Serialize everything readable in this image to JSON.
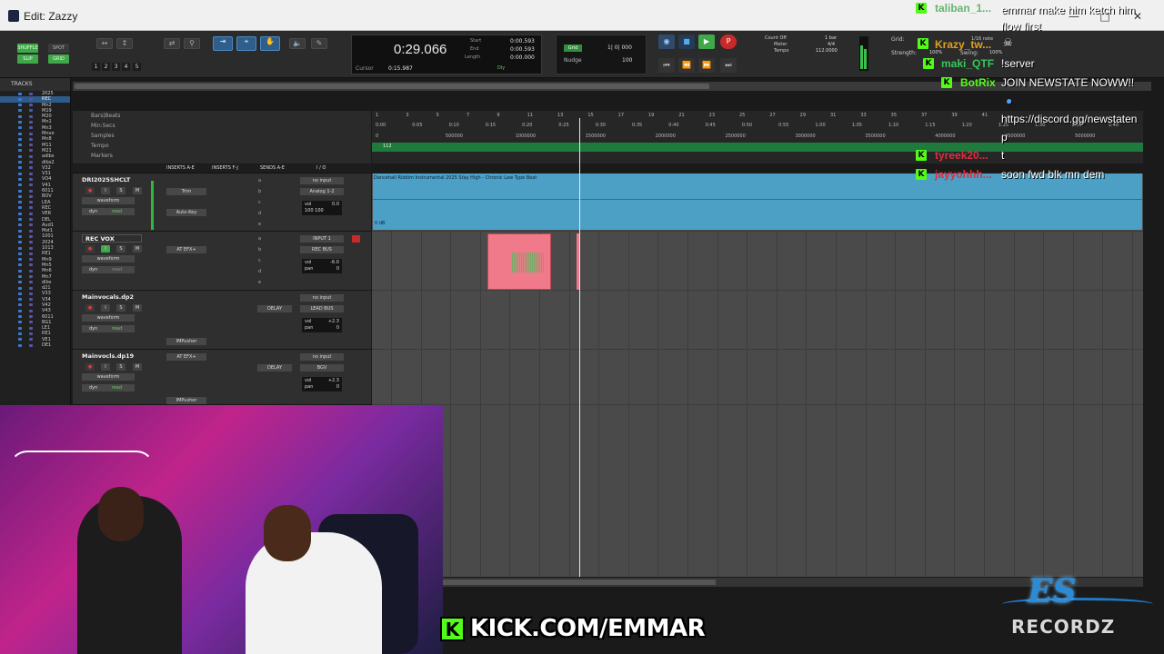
{
  "window": {
    "title": "Edit: Zazzy"
  },
  "toolbar": {
    "modes": [
      "SHUFFLE",
      "SPOT",
      "SLIP",
      "GRID"
    ],
    "zoom_presets": [
      "1",
      "2",
      "3",
      "4",
      "5"
    ],
    "counter": {
      "main": "0:29.066",
      "cursor_label": "Cursor",
      "cursor_value": "0:15.987",
      "start_label": "Start",
      "start_value": "0:00.593",
      "end_label": "End",
      "end_value": "0:00.593",
      "length_label": "Length",
      "length_value": "0:00.000",
      "dly_label": "Dly"
    },
    "grid": {
      "label": "Grid",
      "value": "1| 0| 000",
      "nudge_label": "Nudge",
      "nudge_value": "100"
    },
    "tempo": {
      "count_off": "Count Off",
      "meter": "Meter",
      "tempo_label": "Tempo",
      "bars": "1 bar",
      "meter_value": "4/4",
      "tempo_value": "112.0000"
    },
    "grid_strength": {
      "grid_label": "Grid:",
      "strength_label": "Strength:",
      "note": "1/16 note",
      "strength": "100%",
      "swing_label": "Swing:",
      "swing": "100%"
    }
  },
  "tracks_panel": {
    "header": "TRACKS",
    "items": [
      "2025",
      "REC",
      "Mn2",
      "M19",
      "M20",
      "Mn1",
      "Mn3",
      "Mnvo",
      "Mn8",
      "M11",
      "M21",
      "adlbs",
      "dlbs2",
      "V32",
      "V31",
      "VO4",
      "V41",
      "6011",
      "BOV",
      "LEA",
      "REC",
      "VER",
      "DEL",
      "Aud1",
      "Mst1",
      "1001",
      "2024",
      "1013",
      "RE1",
      "Mn9",
      "Mn5",
      "Mn6",
      "Mn7",
      "dlbs",
      "d21",
      "V33",
      "V34",
      "V42",
      "V43",
      "6011",
      "BG1",
      "LE1",
      "RE1",
      "VE1",
      "DE1"
    ]
  },
  "rulers": {
    "labels": [
      "Bars|Beats",
      "Min:Secs",
      "Samples",
      "Tempo",
      "Markers"
    ],
    "bars": [
      "1",
      "3",
      "5",
      "7",
      "9",
      "11",
      "13",
      "15",
      "17",
      "19",
      "21",
      "23",
      "25",
      "27",
      "29",
      "31",
      "33",
      "35",
      "37",
      "39",
      "41"
    ],
    "minsecs": [
      "0:00",
      "0:05",
      "0:10",
      "0:15",
      "0:20",
      "0:25",
      "0:30",
      "0:35",
      "0:40",
      "0:45",
      "0:50",
      "0:55",
      "1:00",
      "1:05",
      "1:10",
      "1:15",
      "1:20",
      "1:25",
      "1:30",
      "1:35",
      "1:40"
    ],
    "samples": [
      "0",
      "500000",
      "1000000",
      "1500000",
      "2000000",
      "2500000",
      "3000000",
      "3500000",
      "4000000",
      "4500000",
      "5000000"
    ],
    "tempo_value": "112"
  },
  "columns": {
    "inserts_ae": "INSERTS A-E",
    "inserts_fj": "INSERTS F-J",
    "sends_ae": "SENDS A-E",
    "io": "I / O"
  },
  "tracks": [
    {
      "name": "DRI2025SHCLT",
      "view": "waveform",
      "dyn": "dyn",
      "mode": "read",
      "insert1": "Trim",
      "insert2": "Auto-Key",
      "input": "no input",
      "output": "Analog 1-2",
      "vol": "0.0",
      "pan": "100 100",
      "vol_label": "vol"
    },
    {
      "name": "REC VOX",
      "view": "waveform",
      "dyn": "dyn",
      "mode": "read",
      "insert1": "AT EFX+",
      "input": "INPUT 1",
      "output": "REC BUS",
      "vol": "-6.0",
      "pan": "0",
      "vol_label": "vol",
      "pan_label": "pan"
    },
    {
      "name": "Mainvocals.dp2",
      "view": "waveform",
      "dyn": "dyn",
      "mode": "read",
      "insert1": "IMPusher",
      "send": "DELAY",
      "input": "no input",
      "output": "LEAD BUS",
      "vol": "+2.3",
      "pan": "0",
      "vol_label": "vol",
      "pan_label": "pan"
    },
    {
      "name": "Mainvocls.dp19",
      "view": "waveform",
      "dyn": "dyn",
      "mode": "read",
      "insert1": "AT EFX+",
      "insert2": "IMPusher",
      "send": "DELAY",
      "input": "no input",
      "output": "BGV",
      "vol": "+2.3",
      "pan": "0",
      "vol_label": "vol",
      "pan_label": "pan"
    }
  ],
  "regions": {
    "beat": {
      "name": "Dancehall Riddim Instrumental 2025 Stay High - Chronic Law Type Beat",
      "gain": "0 dB"
    }
  },
  "overlay": {
    "kick_url": "KICK.COM/EMMAR",
    "logo_main": "ES",
    "logo_sub": "RECORDZ"
  },
  "chat": [
    {
      "user": "taliban_1...",
      "user_color": "#2a9a3a",
      "msg": "emmar make him ketch him flow first"
    },
    {
      "user": "Krazy_tw...",
      "user_color": "#e0a020",
      "msg": ""
    },
    {
      "user": "maki_QTF",
      "user_color": "#36c85a",
      "msg": "!server"
    },
    {
      "user": "BotRix",
      "user_color": "#53fc18",
      "msg": "JOIN NEWSTATE NOWW!!"
    },
    {
      "user": "",
      "user_color": "#ffffff",
      "msg": "https://discord.gg/newstaten"
    },
    {
      "user": "",
      "user_color": "#ffffff",
      "msg": "p"
    },
    {
      "user": "tyreek20...",
      "user_color": "#d83040",
      "msg": "t"
    },
    {
      "user": "jayyohhh...",
      "user_color": "#d83040",
      "msg": "soon fwd blk mn dem"
    }
  ]
}
